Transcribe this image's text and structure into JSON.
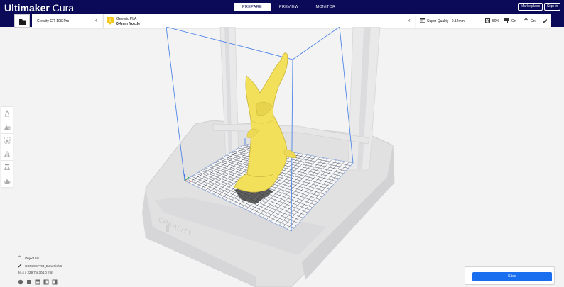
{
  "header": {
    "brand_bold": "Ultimaker",
    "brand_light": "Cura",
    "tabs": [
      {
        "label": "PREPARE",
        "active": true
      },
      {
        "label": "PREVIEW",
        "active": false
      },
      {
        "label": "MONITOR",
        "active": false
      }
    ],
    "marketplace_label": "Marketplace",
    "signin_label": "Sign in"
  },
  "toolbar": {
    "printer": "Creality CR-10S Pro",
    "material_name": "Generic PLA",
    "nozzle": "0.4mm Nozzle",
    "quality": "Super Quality - 0.12mm",
    "infill": "50%",
    "support": "On",
    "adhesion": "On"
  },
  "object": {
    "list_label": "Object list",
    "name": "CCR10SPRO_BoneFishB",
    "dimensions": "94.4 x 229.7 x 304.0 mm"
  },
  "slice_label": "Slice",
  "colors": {
    "header": "#0a0a58",
    "accent": "#196ef0",
    "model": "#f2e05a",
    "material": "#f2c81a"
  }
}
